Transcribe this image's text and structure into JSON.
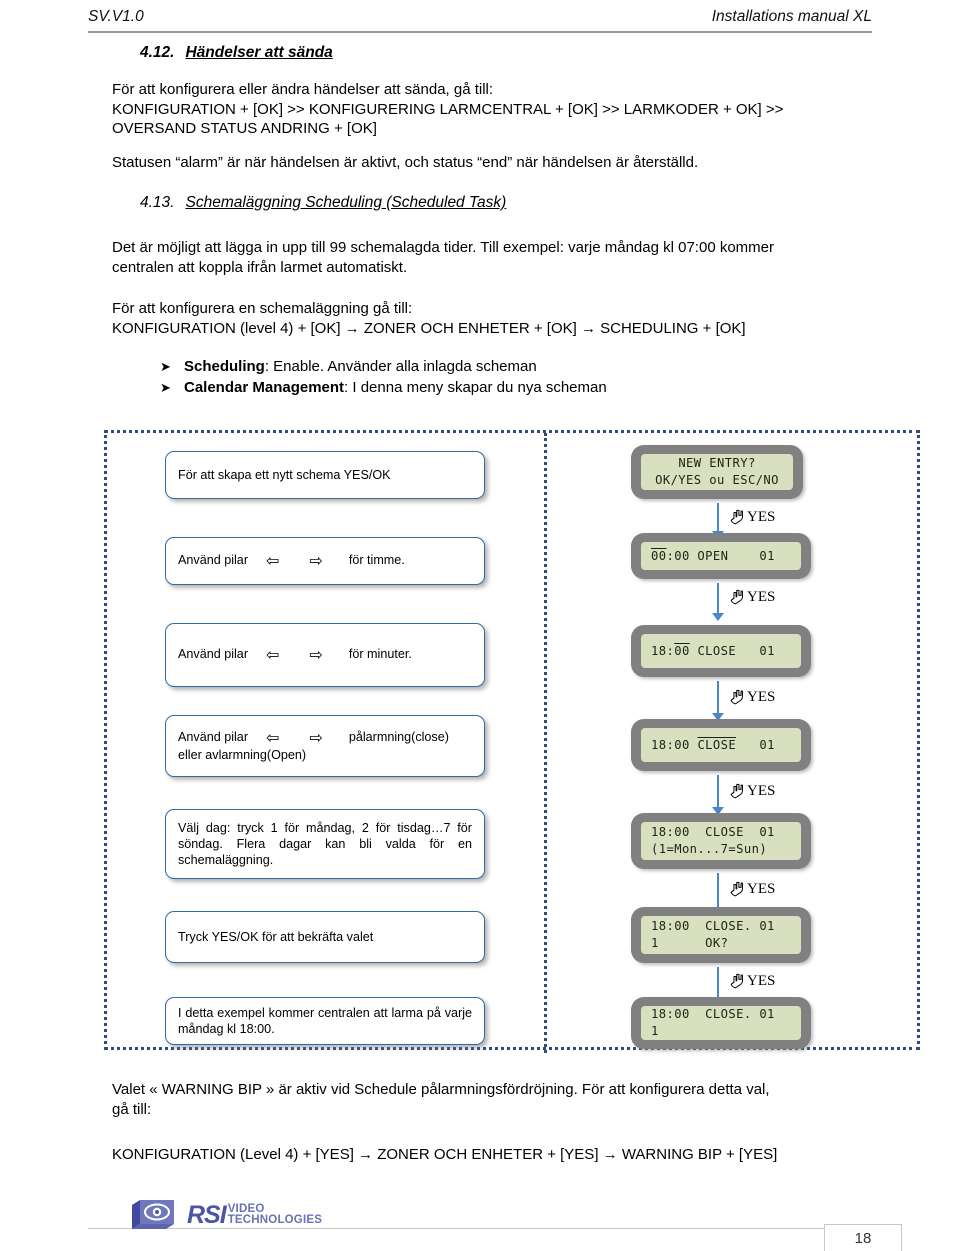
{
  "header": {
    "left": "SV.V1.0",
    "right": "Installations manual XL"
  },
  "sections": {
    "s412": {
      "number": "4.12.",
      "title": "Händelser att sända"
    },
    "s413": {
      "number": "4.13.",
      "title": "Schemaläggning Scheduling (Scheduled Task)"
    }
  },
  "body": {
    "p1": "För att konfigurera eller ändra händelser att sända, gå till:",
    "p2": "KONFIGURATION + [OK] >> KONFIGURERING LARMCENTRAL + [OK] >> LARMKODER + OK] >>",
    "p3": "OVERSAND STATUS ANDRING + [OK]",
    "p4": "Statusen “alarm” är när händelsen är aktivt, och status “end” när händelsen är återställd.",
    "p5": "Det är möjligt att lägga in upp till 99 schemalagda tider. Till exempel: varje måndag kl 07:00 kommer",
    "p6": "centralen att koppla ifrån larmet automatiskt.",
    "p7": "För att konfigurera en schemaläggning gå till:",
    "p8": "KONFIGURATION (level 4) + [OK] → ZONER OCH ENHETER + [OK] → SCHEDULING + [OK]"
  },
  "bullets": [
    {
      "bold": "Scheduling",
      "rest": ": Enable. Använder alla inlagda scheman"
    },
    {
      "bold": "Calendar Management",
      "rest": ": I denna meny skapar du nya scheman"
    }
  ],
  "flow": {
    "steps": [
      {
        "box_text": "För att skapa ett nytt schema YES/OK",
        "lcd_line1": "NEW ENTRY?",
        "lcd_line2": "OK/YES ou ESC/NO",
        "arrow_label": "YES"
      },
      {
        "box_prefix": "Använd pilar",
        "box_arrow_left": "⇦",
        "box_arrow_right": "⇨",
        "box_suffix": "för timme.",
        "lcd_line1_a": "00",
        "lcd_line1_b": ":00 OPEN    01",
        "arrow_label": "YES"
      },
      {
        "box_prefix": "Använd  pilar",
        "box_arrow_left": "⇦",
        "box_arrow_right": "⇨",
        "box_suffix": "för minuter.",
        "lcd_line1_a": "18:",
        "lcd_line1_b": "00",
        "lcd_line1_c": " CLOSE   01",
        "arrow_label": "YES"
      },
      {
        "box_prefix": "Använd pilar",
        "box_arrow_left": "⇦",
        "box_arrow_right": "⇨",
        "box_suffix": "pålarmning(close)",
        "box_line2": "eller avlarmning(Open)",
        "lcd_line1_a": "18:00 ",
        "lcd_line1_b": "CLOSE",
        "lcd_line1_c": "   01",
        "arrow_label": "YES"
      },
      {
        "box_text": "Välj dag: tryck 1 för måndag, 2 för tisdag…7 för söndag. Flera dagar kan bli valda för en schemaläggning.",
        "lcd_line1": "18:00  CLOSE  01",
        "lcd_line2": "(1=Mon...7=Sun)",
        "arrow_label": "YES"
      },
      {
        "box_text": "Tryck YES/OK för att bekräfta valet",
        "lcd_line1": "18:00  CLOSE. 01",
        "lcd_line2": "1      OK?",
        "arrow_label": "YES"
      },
      {
        "box_text": "I detta exempel kommer centralen att larma på varje måndag kl 18:00.",
        "lcd_line1": "18:00  CLOSE. 01",
        "lcd_line2": "1"
      }
    ]
  },
  "bottom": {
    "p1": "Valet « WARNING BIP » är aktiv vid Schedule pålarmningsfördröjning. För att konfigurera detta val,",
    "p2": "gå till:",
    "p3": "KONFIGURATION (Level 4) + [YES] → ZONER OCH ENHETER + [YES] → WARNING BIP + [YES]"
  },
  "footer": {
    "logo_main": "RSI",
    "logo_line1": "VIDEO",
    "logo_line2": "TECHNOLOGIES",
    "page_number": "18"
  },
  "colors": {
    "accent_blue": "#2e6ca3",
    "arrow_blue": "#4a86c8",
    "lcd_green": "#d9e0c0",
    "lcd_bezel": "#808080",
    "dotted_border": "#2e4c80",
    "logo_purple": "#4b55a8"
  }
}
